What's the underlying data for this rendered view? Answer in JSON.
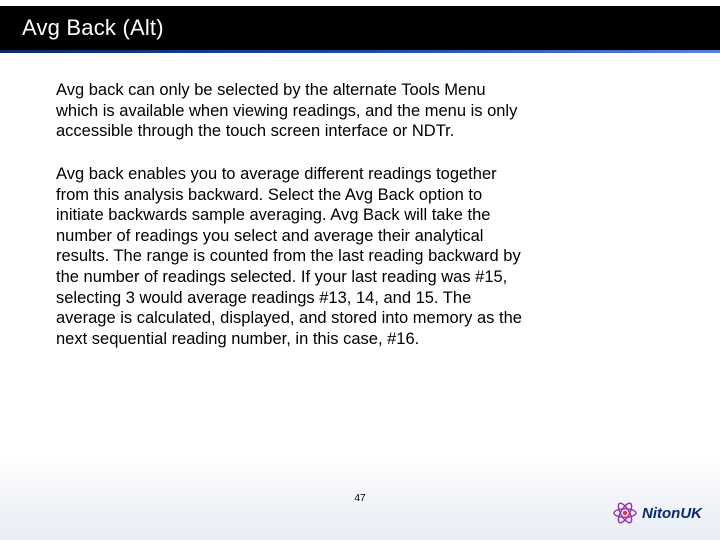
{
  "slide": {
    "title": "Avg Back (Alt)",
    "paragraph1": "Avg back can only be selected by the alternate Tools Menu which is available when viewing readings, and the menu is only accessible through the touch screen interface or NDTr.",
    "paragraph2": "Avg back enables you to average different readings together from this analysis backward. Select the Avg Back option to initiate backwards sample averaging. Avg Back will take the number of readings you select and average their analytical results. The range is counted from the last reading backward by the number of readings selected. If your last reading was #15, selecting 3 would average readings #13, 14, and 15. The average is calculated, displayed, and stored into memory as the next sequential reading number, in this case, #16.",
    "page_number": "47"
  },
  "logo": {
    "text": "NitonUK"
  }
}
